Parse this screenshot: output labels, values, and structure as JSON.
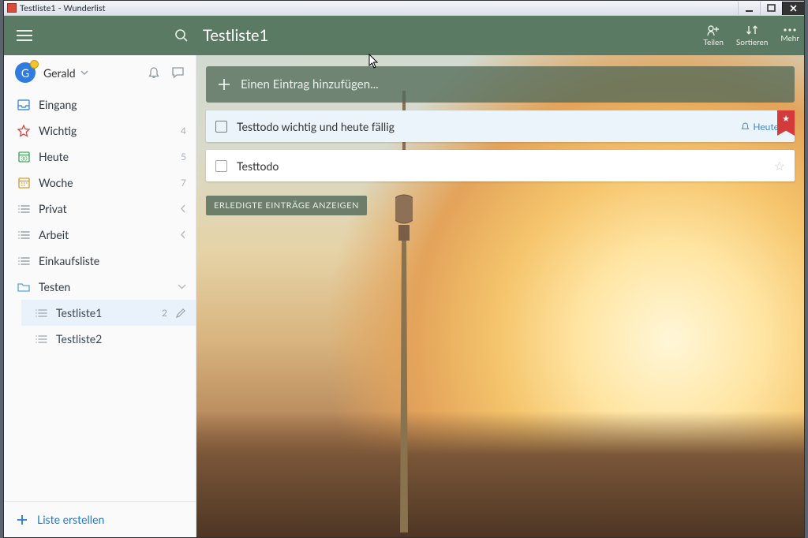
{
  "window": {
    "title": "Testliste1 - Wunderlist"
  },
  "header": {
    "list_title": "Testliste1",
    "actions": {
      "share": "Teilen",
      "sort": "Sortieren",
      "more": "Mehr"
    }
  },
  "user": {
    "initial": "G",
    "name": "Gerald"
  },
  "smartlists": {
    "inbox": {
      "label": "Eingang"
    },
    "important": {
      "label": "Wichtig",
      "count": "4"
    },
    "today": {
      "label": "Heute",
      "count": "5"
    },
    "week": {
      "label": "Woche",
      "count": "7"
    },
    "privat": {
      "label": "Privat"
    },
    "arbeit": {
      "label": "Arbeit"
    },
    "einkauf": {
      "label": "Einkaufsliste"
    }
  },
  "folder": {
    "name": "Testen",
    "lists": [
      {
        "label": "Testliste1",
        "count": "2"
      },
      {
        "label": "Testliste2"
      }
    ]
  },
  "newlist_label": "Liste erstellen",
  "addbar_placeholder": "Einen Eintrag hinzufügen...",
  "tasks": [
    {
      "title": "Testtodo wichtig und heute fällig",
      "due": "Heute",
      "flagged": true,
      "selected": true
    },
    {
      "title": "Testtodo",
      "flagged": false,
      "selected": false
    }
  ],
  "show_completed_label": "ERLEDIGTE EINTRÄGE ANZEIGEN",
  "colors": {
    "green": "#5b7a63",
    "accent_blue": "#1f7bd1",
    "flag_red": "#d33a3a"
  }
}
